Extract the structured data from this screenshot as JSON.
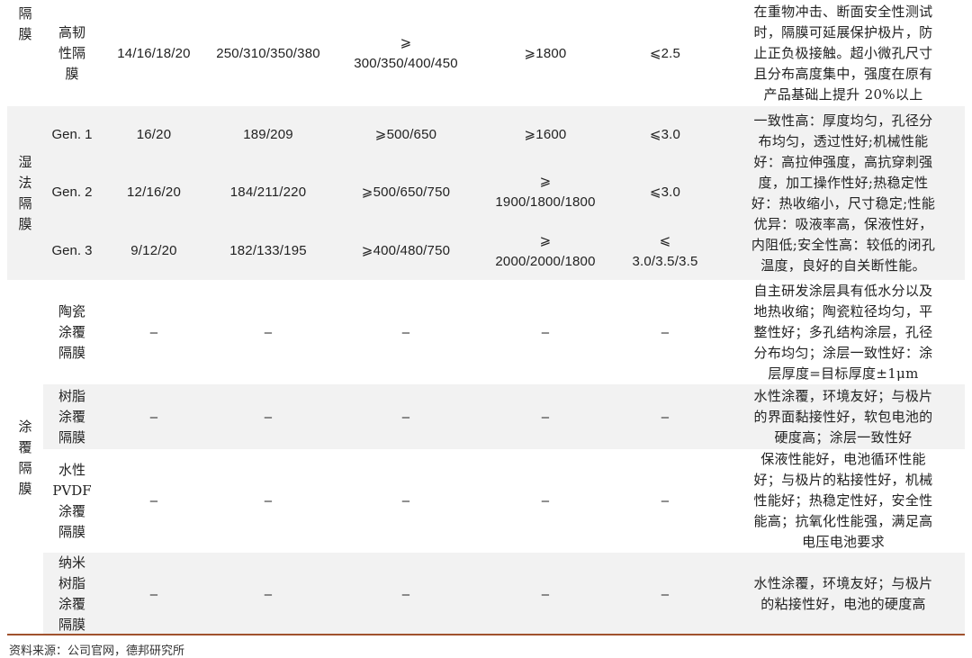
{
  "table": {
    "groups": {
      "dry": "隔\n膜",
      "wet": "湿\n法\n隔\n膜",
      "coat": "涂\n覆\n隔\n膜"
    },
    "rows": [
      {
        "name": "高韧\n性隔\n膜",
        "c1": "14/16/18/20",
        "c2": "250/310/350/380",
        "c3": "⩾\n300/350/400/450",
        "c4": "⩾1800",
        "c5": "⩽2.5",
        "desc": "在重物冲击、断面安全性测试\n时，隔膜可延展保护极片，防\n止正负极接触。超小微孔尺寸\n且分布高度集中，强度在原有\n产品基础上提升 20%以上"
      },
      {
        "name": "Gen. 1",
        "c1": "16/20",
        "c2": "189/209",
        "c3": "⩾500/650",
        "c4": "⩾1600",
        "c5": "⩽3.0",
        "desc": "一致性高：厚度均匀，孔径分\n布均匀，透过性好;机械性能\n好：高拉伸强度，高抗穿刺强\n度，加工操作性好;热稳定性\n好：热收缩小，尺寸稳定;性能\n优异：吸液率高，保液性好，\n内阻低;安全性高：较低的闭孔\n温度，良好的自关断性能。"
      },
      {
        "name": "Gen. 2",
        "c1": "12/16/20",
        "c2": "184/211/220",
        "c3": "⩾500/650/750",
        "c4": "⩾\n1900/1800/1800",
        "c5": "⩽3.0"
      },
      {
        "name": "Gen. 3",
        "c1": "9/12/20",
        "c2": "182/133/195",
        "c3": "⩾400/480/750",
        "c4": "⩾\n2000/2000/1800",
        "c5": "⩽\n3.0/3.5/3.5"
      },
      {
        "name": "陶瓷\n涂覆\n隔膜",
        "c1": "–",
        "c2": "–",
        "c3": "–",
        "c4": "–",
        "c5": "–",
        "desc": "自主研发涂层具有低水分以及\n地热收缩；陶瓷粒径均匀，平\n整性好；多孔结构涂层，孔径\n分布均匀；涂层一致性好：涂\n层厚度=目标厚度±1μm"
      },
      {
        "name": "树脂\n涂覆\n隔膜",
        "c1": "–",
        "c2": "–",
        "c3": "–",
        "c4": "–",
        "c5": "–",
        "desc": "水性涂覆，环境友好；与极片\n的界面黏接性好，软包电池的\n硬度高；涂层一致性好"
      },
      {
        "name": "水性\nPVDF\n涂覆\n隔膜",
        "c1": "–",
        "c2": "–",
        "c3": "–",
        "c4": "–",
        "c5": "–",
        "desc": "保液性能好，电池循环性能\n好；与极片的粘接性好，机械\n性能好；热稳定性好，安全性\n能高；抗氧化性能强，满足高\n电压电池要求"
      },
      {
        "name": "纳米\n树脂\n涂覆\n隔膜",
        "c1": "–",
        "c2": "–",
        "c3": "–",
        "c4": "–",
        "c5": "–",
        "desc": "水性涂覆，环境友好；与极片\n的粘接性好，电池的硬度高"
      }
    ]
  },
  "source": "资料来源：公司官网，德邦研究所"
}
